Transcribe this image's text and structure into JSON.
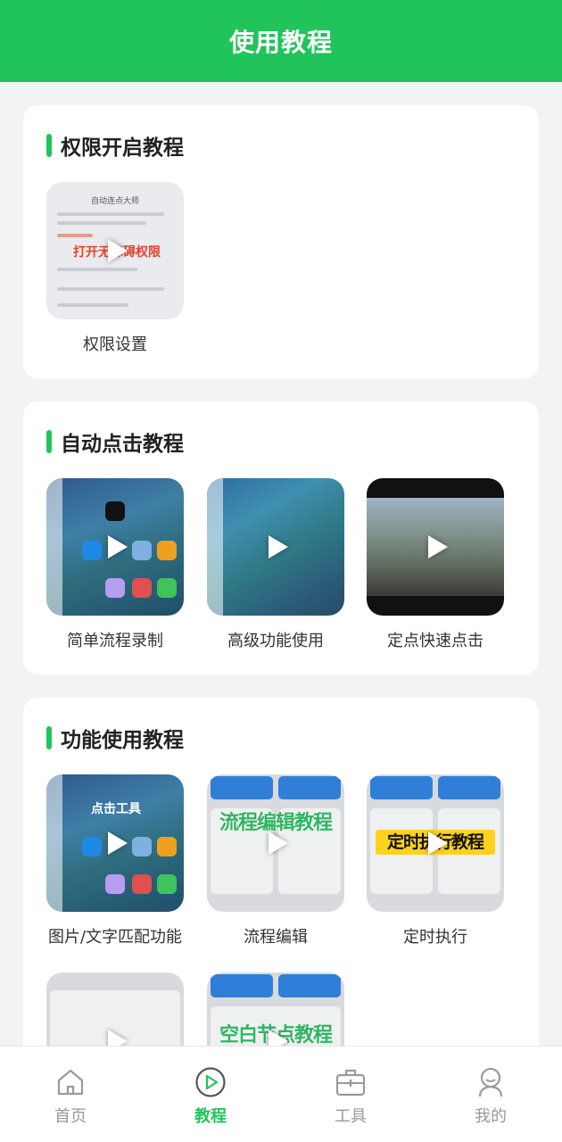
{
  "header": {
    "title": "使用教程"
  },
  "sections": [
    {
      "title": "权限开启教程",
      "videos": [
        {
          "label": "权限设置"
        }
      ]
    },
    {
      "title": "自动点击教程",
      "videos": [
        {
          "label": "简单流程录制"
        },
        {
          "label": "高级功能使用"
        },
        {
          "label": "定点快速点击"
        }
      ]
    },
    {
      "title": "功能使用教程",
      "videos": [
        {
          "label": "图片/文字匹配功能"
        },
        {
          "label": "流程编辑"
        },
        {
          "label": "定时执行"
        },
        {
          "label": ""
        },
        {
          "label": ""
        }
      ]
    }
  ],
  "thumb_text": {
    "perm_title": "自动连点大师",
    "perm_overlay": "打开无障碍权限",
    "tap_tool": "点击工具",
    "flow_edit": "流程编辑教程",
    "timer": "定时执行教程",
    "blank_node": "空白节点教程"
  },
  "tabbar": {
    "items": [
      {
        "label": "首页",
        "icon": "home-icon"
      },
      {
        "label": "教程",
        "icon": "play-circle-icon",
        "active": true
      },
      {
        "label": "工具",
        "icon": "toolbox-icon"
      },
      {
        "label": "我的",
        "icon": "user-icon"
      }
    ]
  },
  "colors": {
    "brand": "#20c45a",
    "text": "#333333",
    "inactive": "#999999"
  }
}
